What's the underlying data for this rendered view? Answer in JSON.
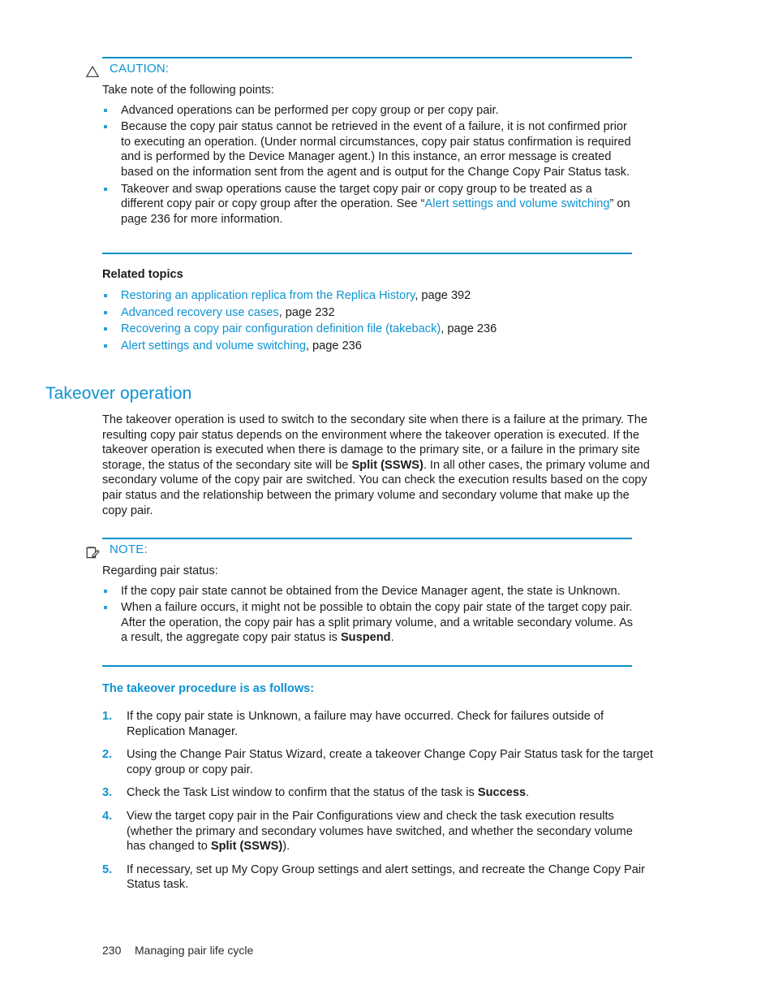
{
  "colors": {
    "accent_blue": "#0d93d2",
    "rule_blue": "#0d8ec9",
    "body_text": "#1c1c1c"
  },
  "caution": {
    "icon": "warning-triangle-icon",
    "label": "CAUTION:",
    "intro": "Take note of the following points:",
    "bullets": [
      {
        "parts": [
          {
            "text": "Advanced operations can be performed per copy group or per copy pair.",
            "style": "normal"
          }
        ]
      },
      {
        "parts": [
          {
            "text": "Because the copy pair status cannot be retrieved in the event of a failure, it is not confirmed prior to executing an operation. (Under normal circumstances, copy pair status confirmation is required and is performed by the Device Manager agent.) In this instance, an error message is created based on the information sent from the agent and is output for the Change Copy Pair Status task.",
            "style": "normal"
          }
        ]
      },
      {
        "parts": [
          {
            "text": "Takeover and swap operations cause the target copy pair or copy group to be treated as a different copy pair or copy group after the operation. See “",
            "style": "normal"
          },
          {
            "text": "Alert settings and volume switching",
            "style": "link"
          },
          {
            "text": "” on page 236 for more information.",
            "style": "normal"
          }
        ]
      }
    ]
  },
  "related_topics": {
    "heading": "Related topics",
    "items": [
      {
        "link": "Restoring an application replica from the Replica History",
        "suffix": ", page 392"
      },
      {
        "link": "Advanced recovery use cases",
        "suffix": ", page 232"
      },
      {
        "link": "Recovering a copy pair configuration definition file (takeback)",
        "suffix": ", page 236"
      },
      {
        "link": "Alert settings and volume switching",
        "suffix": ", page 236"
      }
    ]
  },
  "takeover_section": {
    "heading": "Takeover operation",
    "paragraph_parts": [
      {
        "text": "The takeover operation is used to switch to the secondary site when there is a failure at the primary. The resulting copy pair status depends on the environment where the takeover operation is executed. If the takeover operation is executed when there is damage to the primary site, or a failure in the primary site storage, the status of the secondary site will be ",
        "style": "normal"
      },
      {
        "text": "Split (SSWS)",
        "style": "bold"
      },
      {
        "text": ". In all other cases, the primary volume and secondary volume of the copy pair are switched. You can check the execution results based on the copy pair status and the relationship between the primary volume and secondary volume that make up the copy pair.",
        "style": "normal"
      }
    ]
  },
  "note": {
    "icon": "notepad-pencil-icon",
    "label": "NOTE:",
    "intro": "Regarding pair status:",
    "bullets": [
      {
        "parts": [
          {
            "text": "If the copy pair state cannot be obtained from the Device Manager agent, the state is Unknown.",
            "style": "normal"
          }
        ]
      },
      {
        "parts": [
          {
            "text": "When a failure occurs, it might not be possible to obtain the copy pair state of the target copy pair. After the operation, the copy pair has a split primary volume, and a writable secondary volume. As a result, the aggregate copy pair status is ",
            "style": "normal"
          },
          {
            "text": "Suspend",
            "style": "bold"
          },
          {
            "text": ".",
            "style": "normal"
          }
        ]
      }
    ]
  },
  "procedure": {
    "heading": "The takeover procedure is as follows:",
    "steps": [
      {
        "number": "1.",
        "parts": [
          {
            "text": "If the copy pair state is Unknown, a failure may have occurred. Check for failures outside of Replication Manager.",
            "style": "normal"
          }
        ]
      },
      {
        "number": "2.",
        "parts": [
          {
            "text": "Using the Change Pair Status Wizard, create a takeover Change Copy Pair Status task for the target copy group or copy pair.",
            "style": "normal"
          }
        ]
      },
      {
        "number": "3.",
        "parts": [
          {
            "text": "Check the Task List window to confirm that the status of the task is ",
            "style": "normal"
          },
          {
            "text": "Success",
            "style": "bold"
          },
          {
            "text": ".",
            "style": "normal"
          }
        ]
      },
      {
        "number": "4.",
        "parts": [
          {
            "text": "View the target copy pair in the Pair Configurations view and check the task execution results (whether the primary and secondary volumes have switched, and whether the secondary volume has changed to ",
            "style": "normal"
          },
          {
            "text": "Split (SSWS)",
            "style": "bold"
          },
          {
            "text": ").",
            "style": "normal"
          }
        ]
      },
      {
        "number": "5.",
        "parts": [
          {
            "text": "If necessary, set up My Copy Group settings and alert settings, and recreate the Change Copy Pair Status task.",
            "style": "normal"
          }
        ]
      }
    ]
  },
  "footer": {
    "page_number": "230",
    "chapter_title": "Managing pair life cycle"
  }
}
